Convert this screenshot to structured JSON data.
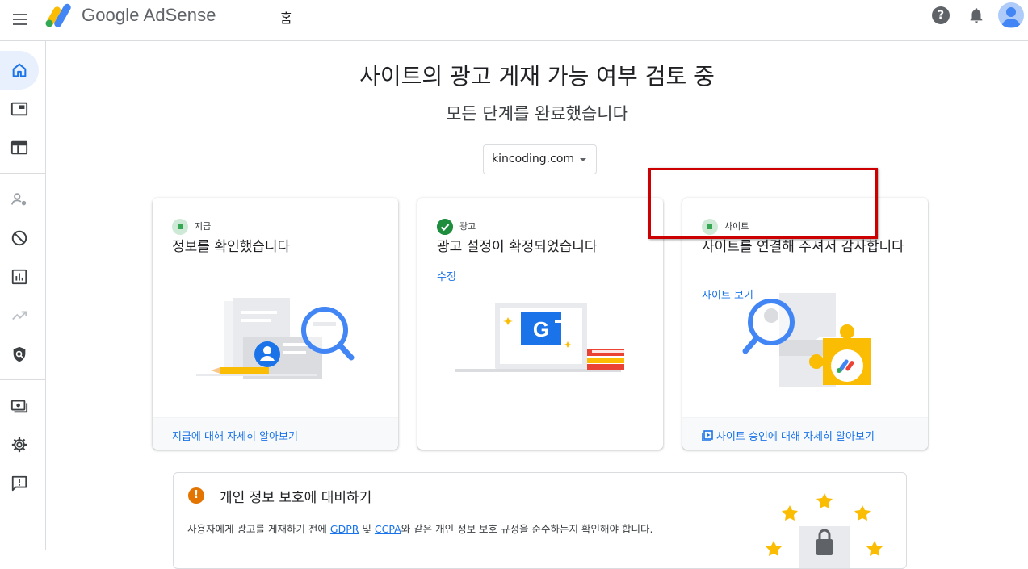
{
  "header": {
    "brand": "Google AdSense",
    "page_title": "홈",
    "help_glyph": "?"
  },
  "sidebar": {
    "items": [
      {
        "icon": "home-icon",
        "active": true
      },
      {
        "icon": "ad-units-icon"
      },
      {
        "icon": "layout-icon"
      },
      {
        "icon": "user-access-icon"
      },
      {
        "icon": "block-icon"
      },
      {
        "icon": "reports-icon"
      },
      {
        "icon": "trend-icon"
      },
      {
        "icon": "policy-shield-icon"
      },
      {
        "icon": "payments-icon"
      },
      {
        "icon": "settings-icon"
      },
      {
        "icon": "feedback-icon"
      }
    ]
  },
  "main": {
    "title": "사이트의 광고 게재 가능 여부 검토 중",
    "subtitle": "모든 단계를 완료했습니다",
    "site_select": "kincoding.com"
  },
  "cards": [
    {
      "tag": "지급",
      "heading": "정보를 확인했습니다",
      "footer": "지급에 대해 자세히 알아보기"
    },
    {
      "tag": "광고",
      "heading": "광고 설정이 확정되었습니다",
      "link": "수정",
      "illus_letter": "G"
    },
    {
      "tag": "사이트",
      "heading": "사이트를 연결해 주셔서 감사합니다",
      "link": "사이트 보기",
      "footer": "사이트 승인에 대해 자세히 알아보기"
    }
  ],
  "privacy": {
    "warn_glyph": "!",
    "title": "개인 정보 보호에 대비하기",
    "body_prefix": "사용자에게 광고를 게재하기 전에 ",
    "gdpr": "GDPR",
    "and": " 및 ",
    "ccpa": "CCPA",
    "body_suffix": "와 같은 개인 정보 보호 규정을 준수하는지 확인해야 합니다."
  },
  "colors": {
    "accent_blue": "#1a73e8",
    "success_green": "#1e8e3e",
    "warning_orange": "#e37400",
    "highlight_red": "#cc0000"
  }
}
